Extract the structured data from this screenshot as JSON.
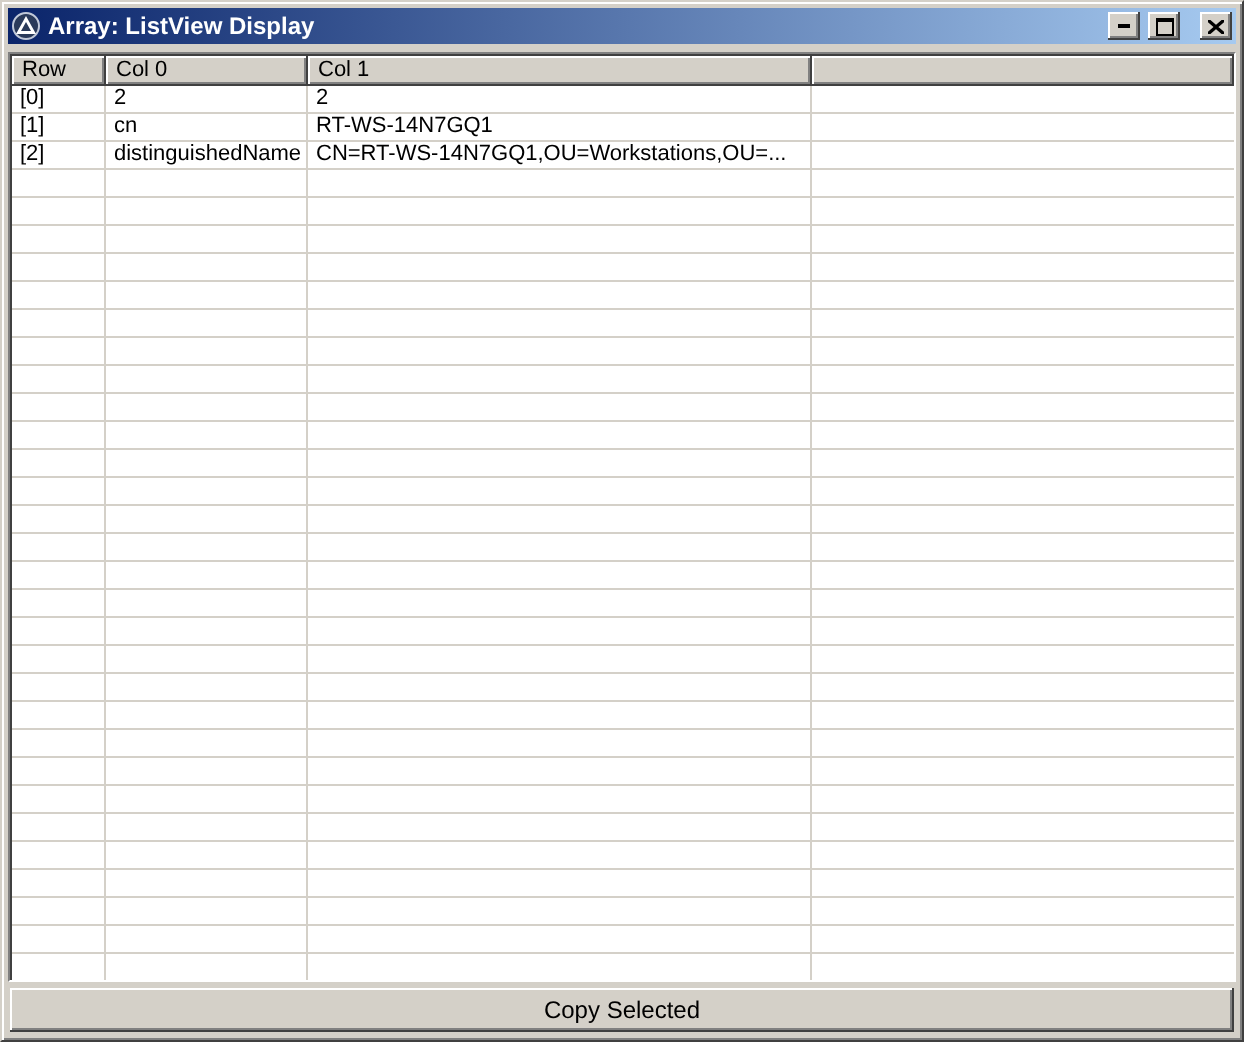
{
  "window": {
    "title": "Array: ListView Display"
  },
  "table": {
    "columns": [
      "Row",
      "Col 0",
      "Col 1"
    ],
    "rows": [
      {
        "cells": [
          "[0]",
          "2",
          "2"
        ]
      },
      {
        "cells": [
          "[1]",
          "cn",
          "RT-WS-14N7GQ1"
        ]
      },
      {
        "cells": [
          "[2]",
          "distinguishedName",
          "CN=RT-WS-14N7GQ1,OU=Workstations,OU=..."
        ]
      }
    ]
  },
  "buttons": [
    "Copy Selected"
  ]
}
